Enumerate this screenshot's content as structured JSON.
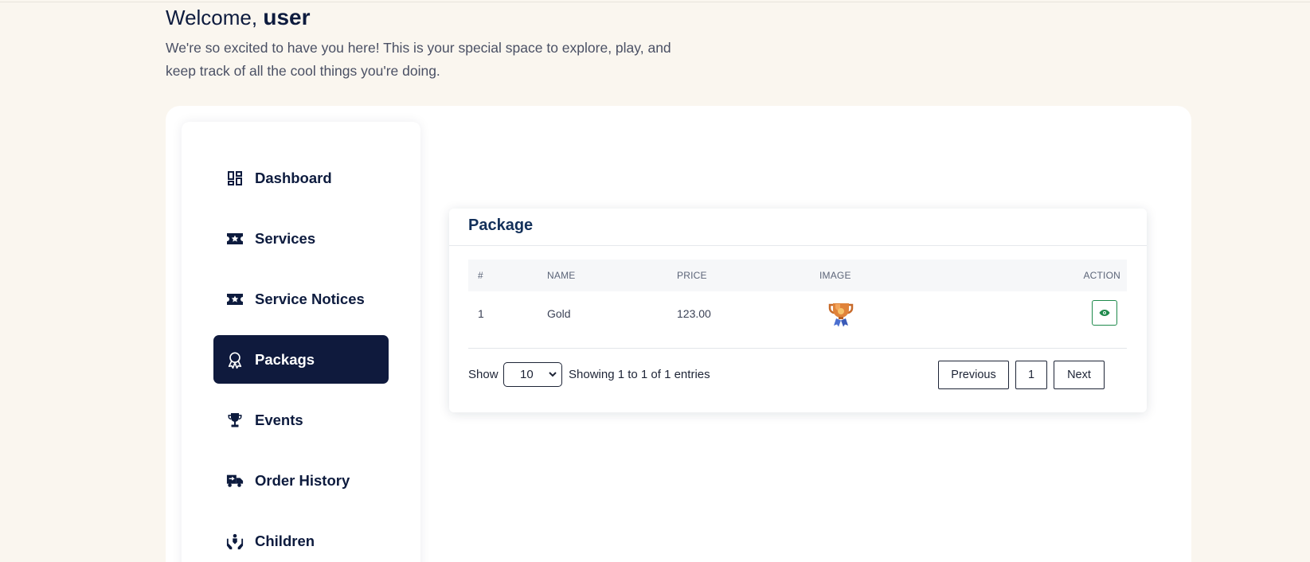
{
  "header": {
    "welcome_prefix": "Welcome,",
    "username": "user",
    "intro": "We're so excited to have you here! This is your special space to explore, play, and keep track of all the cool things you're doing."
  },
  "sidebar": {
    "items": [
      {
        "label": "Dashboard",
        "icon": "dashboard-icon"
      },
      {
        "label": "Services",
        "icon": "ticket-star-icon"
      },
      {
        "label": "Service Notices",
        "icon": "ticket-star-icon"
      },
      {
        "label": "Packags",
        "icon": "award-icon",
        "active": true
      },
      {
        "label": "Events",
        "icon": "trophy-icon"
      },
      {
        "label": "Order History",
        "icon": "delivery-truck-icon"
      },
      {
        "label": "Children",
        "icon": "hands-heart-icon"
      }
    ]
  },
  "package_card": {
    "title": "Package",
    "columns": [
      "#",
      "NAME",
      "PRICE",
      "IMAGE",
      "ACTION"
    ],
    "rows": [
      {
        "index": "1",
        "name": "Gold",
        "price": "123.00",
        "image": "trophy-image"
      }
    ],
    "show_label": "Show",
    "page_length": "10",
    "entries_info": "Showing 1 to 1 of 1 entries",
    "pagination": {
      "previous": "Previous",
      "current_page": "1",
      "next": "Next"
    }
  },
  "colors": {
    "background": "#faf6ef",
    "navy": "#0f1a3d",
    "view_button": "#1f8a4c"
  }
}
